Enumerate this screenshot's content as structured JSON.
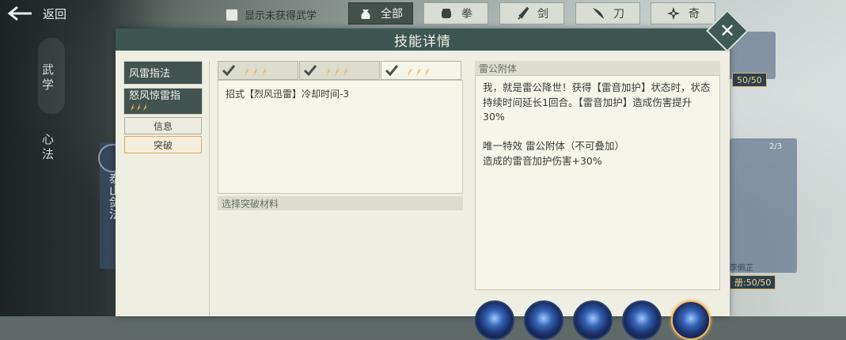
{
  "topbar": {
    "back_label": "返回",
    "filter_label": "显示未获得武学",
    "categories": [
      {
        "label": "全部",
        "icon": "pouch-icon",
        "active": true
      },
      {
        "label": "拳",
        "icon": "fist-icon",
        "active": false
      },
      {
        "label": "剑",
        "icon": "sword-icon",
        "active": false
      },
      {
        "label": "刀",
        "icon": "blade-icon",
        "active": false
      },
      {
        "label": "奇",
        "icon": "shuriken-icon",
        "active": false
      }
    ]
  },
  "background": {
    "side_tabs": [
      "武学",
      "心法"
    ],
    "card_label": "泰山剑法",
    "badges": [
      "50/50",
      "50/50"
    ],
    "badge_count": "2/3",
    "card_name": "李佩芷",
    "card_badge_prefix": "册:"
  },
  "dialog": {
    "title": "技能详情",
    "close_icon": "close-icon",
    "skills": [
      {
        "name": "风雷指法",
        "subtitle": ""
      },
      {
        "name": "怒风惊雷指",
        "subtitle": ""
      }
    ],
    "sub_buttons": [
      {
        "label": "信息",
        "active": false
      },
      {
        "label": "突破",
        "active": true
      }
    ],
    "levels": [
      {
        "checked": true,
        "flames": 3
      },
      {
        "checked": true,
        "flames": 3
      },
      {
        "checked": true,
        "flames": 3
      }
    ],
    "level_effect": "招式【烈风迅雷】冷却时间-3",
    "material_section": "选择突破材料",
    "desc_title": "雷公附体",
    "desc_paragraphs": [
      "我，就是雷公降世！获得【雷音加护】状态时，状态持续时间延长1回合。【雷音加护】造成伤害提升30%",
      "唯一特效 雷公附体（不可叠加）\n造成的雷音加护伤害+30%"
    ],
    "orbs": 5
  },
  "colors": {
    "header": "#3c5652",
    "accent_orange": "#e3a458",
    "flame": "#f0b45a"
  }
}
